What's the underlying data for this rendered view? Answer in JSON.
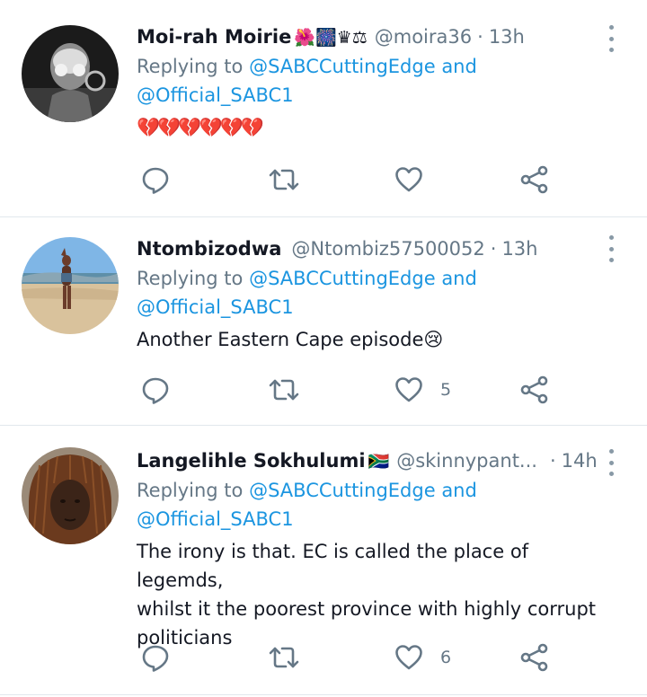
{
  "tweets": [
    {
      "name": "Moi-rah Moirie",
      "name_emoji": "🌺🎆♛⚖",
      "handle": "@moira36",
      "separator": "·",
      "time": "13h",
      "replying_prefix": "Replying to ",
      "mention1": "@SABCCuttingEdge",
      "and_word": " and",
      "mention2": "@Official_SABC1",
      "text": "💔💔💔💔💔💔",
      "like_count": "",
      "icons": [
        "reply-icon",
        "retweet-icon",
        "like-icon",
        "share-icon",
        "more-icon"
      ]
    },
    {
      "name": "Ntombizodwa",
      "name_emoji": "",
      "handle": "@Ntombiz57500052",
      "separator": "·",
      "time": "13h",
      "replying_prefix": "Replying to ",
      "mention1": "@SABCCuttingEdge",
      "and_word": " and",
      "mention2": "@Official_SABC1",
      "text": "Another Eastern Cape episode😢",
      "like_count": "5",
      "icons": [
        "reply-icon",
        "retweet-icon",
        "like-icon",
        "share-icon",
        "more-icon"
      ]
    },
    {
      "name": "Langelihle Sokhulumi",
      "name_emoji": "🇿🇦",
      "handle": "@skinnypant...",
      "separator": "·",
      "time": "14h",
      "replying_prefix": "Replying to ",
      "mention1": "@SABCCuttingEdge",
      "and_word": " and",
      "mention2": "@Official_SABC1",
      "text": "The irony is that. EC is called the place of legemds,\nwhilst it the poorest province with highly corrupt\npoliticians",
      "like_count": "6",
      "icons": [
        "reply-icon",
        "retweet-icon",
        "like-icon",
        "share-icon",
        "more-icon"
      ]
    }
  ],
  "colors": {
    "link": "#1b95e0",
    "secondary": "#657786",
    "icon": "#657786",
    "divider": "#e1e8ed"
  }
}
